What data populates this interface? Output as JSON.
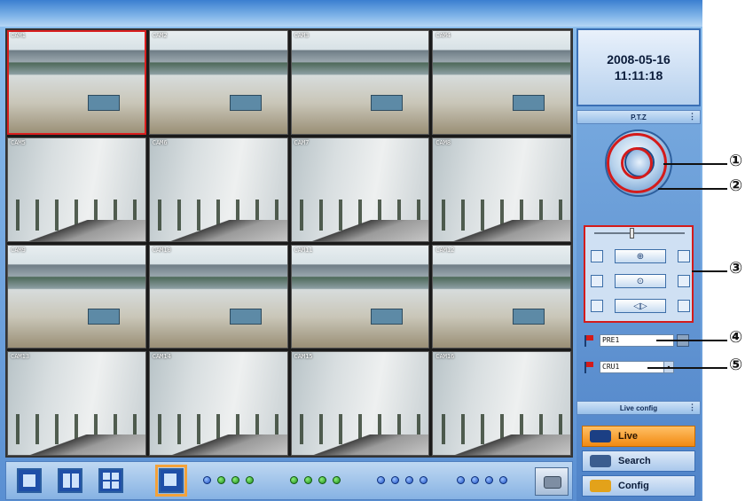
{
  "datetime": {
    "date": "2008-05-16",
    "time": "11:11:18"
  },
  "cameras": [
    {
      "label": "CAM1"
    },
    {
      "label": "CAM2"
    },
    {
      "label": "CAM3"
    },
    {
      "label": "CAM4"
    },
    {
      "label": "CAM5"
    },
    {
      "label": "CAM6"
    },
    {
      "label": "CAM7"
    },
    {
      "label": "CAM8"
    },
    {
      "label": "CAM9"
    },
    {
      "label": "CAM10"
    },
    {
      "label": "CAM11"
    },
    {
      "label": "CAM12"
    },
    {
      "label": "CAM13"
    },
    {
      "label": "CAM14"
    },
    {
      "label": "CAM15"
    },
    {
      "label": "CAM16"
    }
  ],
  "ptz": {
    "title": "P.T.Z",
    "menu_glyph": "⋮",
    "zoom_glyph": "⊕",
    "focus_glyph": "⊙",
    "iris_glyph": "◁▷",
    "preset_value": "PRE1",
    "cruise_value": "CRU1",
    "dropdown_glyph": "▾"
  },
  "live_config": {
    "title": "Live config",
    "menu_glyph": "⋮"
  },
  "nav": {
    "live": "Live",
    "search": "Search",
    "config": "Config"
  },
  "callouts": [
    "①",
    "②",
    "③",
    "④",
    "⑤"
  ],
  "colors": {
    "selected_border": "#d91e1e",
    "active_nav": "#f28a12",
    "annotation_red": "#d41b1b"
  }
}
